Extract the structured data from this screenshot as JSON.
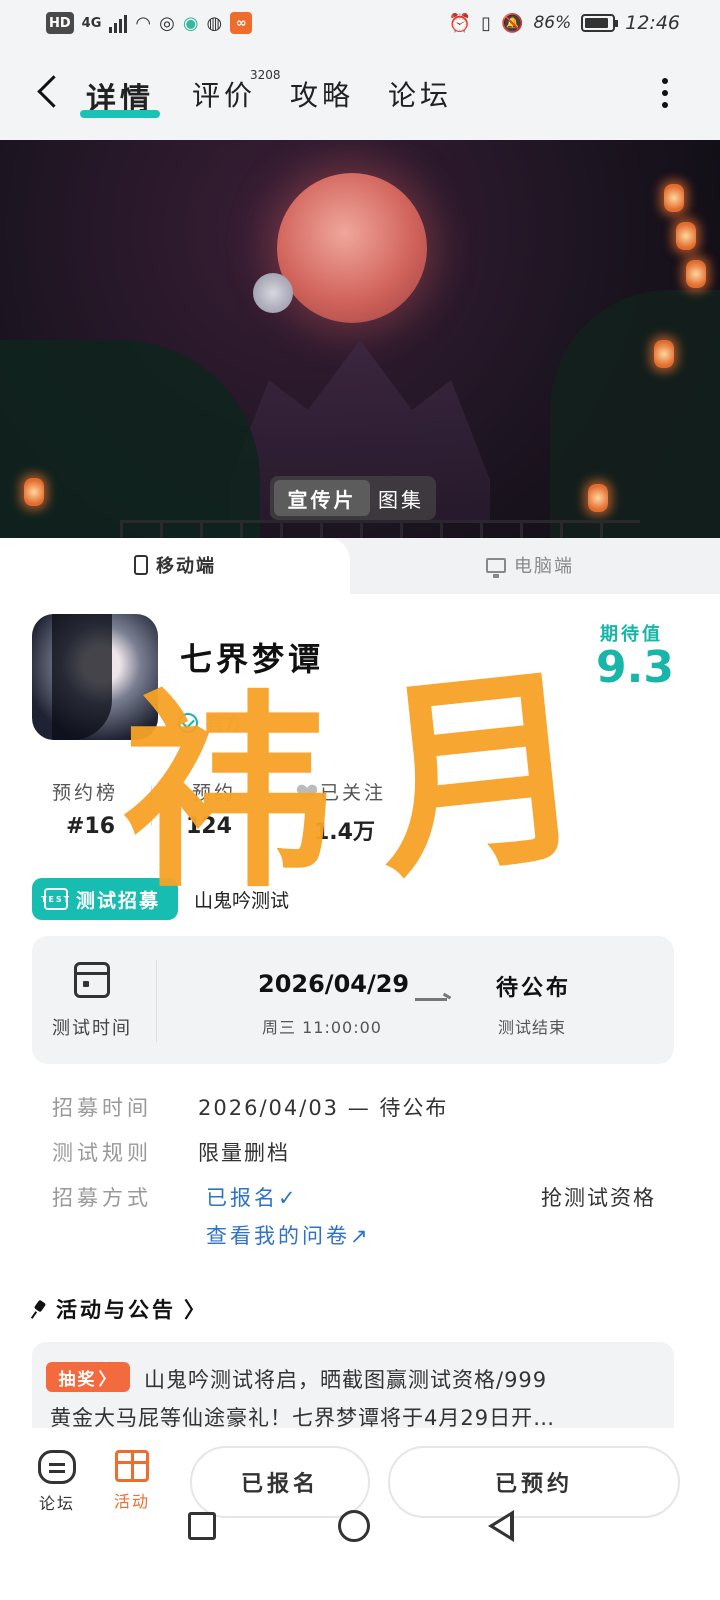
{
  "status_bar": {
    "hd": "HD",
    "network": "4G",
    "battery": "86%",
    "battery_level": 0.86,
    "time": "12:46"
  },
  "header": {
    "tabs": [
      {
        "label": "详情",
        "active": true
      },
      {
        "label": "评价",
        "badge": "3208"
      },
      {
        "label": "攻略"
      },
      {
        "label": "论坛"
      }
    ]
  },
  "banner": {
    "media_options": [
      "宣传片",
      "图集"
    ],
    "selected_media": "宣传片"
  },
  "platform_tabs": [
    "移动端",
    "电脑端"
  ],
  "game": {
    "title": "七界梦谭",
    "official_text": "官方",
    "expect_label": "期待值",
    "expect_score": "9.3",
    "stats": [
      {
        "label": "预约榜",
        "value": "#16"
      },
      {
        "label": "预约",
        "value": "124"
      },
      {
        "label": "已关注",
        "value": "1.4万"
      }
    ],
    "recruit_badge": "测试招募",
    "test_name": "山鬼吟测试"
  },
  "overlay_text": [
    "祎",
    "月"
  ],
  "test_time": {
    "label": "测试时间",
    "start_date": "2026/04/29",
    "start_sub": "周三 11:00:00",
    "end_date": "待公布",
    "end_sub": "测试结束"
  },
  "info_rows": {
    "recruit_time_label": "招募时间",
    "recruit_time_value": "2026/04/03 — 待公布",
    "rules_label": "测试规则",
    "rules_value": "限量删档",
    "method_label": "招募方式",
    "signed_up": "已报名✓",
    "questionnaire_link": "查看我的问卷↗",
    "grab_qualification": "抢测试资格"
  },
  "activities": {
    "heading": "活动与公告",
    "badge": "抽奖",
    "line1": "山鬼吟测试将启，晒截图赢测试资格/999",
    "line2": "黄金大马屁等仙途豪礼！七界梦谭将于4月29日开…"
  },
  "bottom_nav": {
    "forum_label": "论坛",
    "activity_label": "活动",
    "signed_button": "已报名",
    "reserved_button": "已预约"
  },
  "colors": {
    "accent": "#18c3b6",
    "orange": "#ef6c2c",
    "overlay": "#f7a326",
    "link": "#2e73c7"
  }
}
